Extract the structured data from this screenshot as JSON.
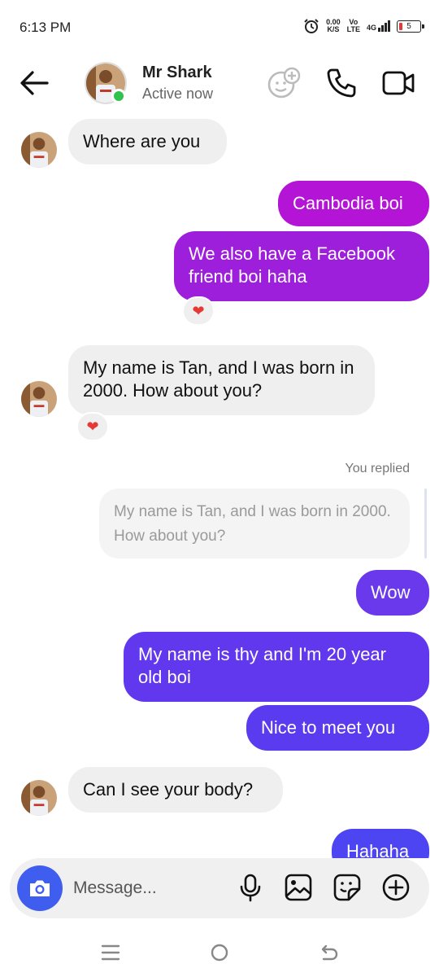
{
  "status_bar": {
    "time": "6:13 PM",
    "speed_value": "0.00",
    "speed_unit": "K/S",
    "volte_top": "Vo",
    "volte_bottom": "LTE",
    "network": "4G",
    "battery": "5",
    "battery_color": "#e53935"
  },
  "header": {
    "contact_name": "Mr Shark",
    "contact_status": "Active now",
    "online_color": "#31c24d"
  },
  "messages": [
    {
      "direction": "in",
      "text": "Where are you"
    },
    {
      "direction": "out",
      "text": "Cambodia boi",
      "color": "#b314d6"
    },
    {
      "direction": "out",
      "text": "We also have a Facebook friend boi haha",
      "color": "#9d1fdc",
      "reaction": "heart"
    },
    {
      "direction": "in",
      "text": "My name is Tan, and I was born in 2000. How about you?",
      "reaction": "heart"
    },
    {
      "direction": "out",
      "text": "Wow",
      "color": "#6a39ec",
      "reply_label": "You replied",
      "reply_to": "My name is Tan, and I was born in 2000. How about you?"
    },
    {
      "direction": "out",
      "text": "My name is thy and I'm 20 year old boi",
      "color": "#6138ee"
    },
    {
      "direction": "out",
      "text": "Nice to meet you",
      "color": "#5a3bf0"
    },
    {
      "direction": "in",
      "text": "Can I see your body?"
    },
    {
      "direction": "out",
      "text": "Hahaha",
      "color": "#4d45f2"
    }
  ],
  "reaction_glyph": "❤",
  "composer": {
    "placeholder": "Message...",
    "camera_color": "#3f5ef0"
  },
  "icons": {
    "back": "arrow-left-icon",
    "effects": "effects-icon",
    "call": "phone-icon",
    "video": "video-camera-icon",
    "camera": "camera-icon",
    "mic": "microphone-icon",
    "gallery": "image-icon",
    "sticker": "sticker-icon",
    "plus": "plus-circle-icon"
  }
}
